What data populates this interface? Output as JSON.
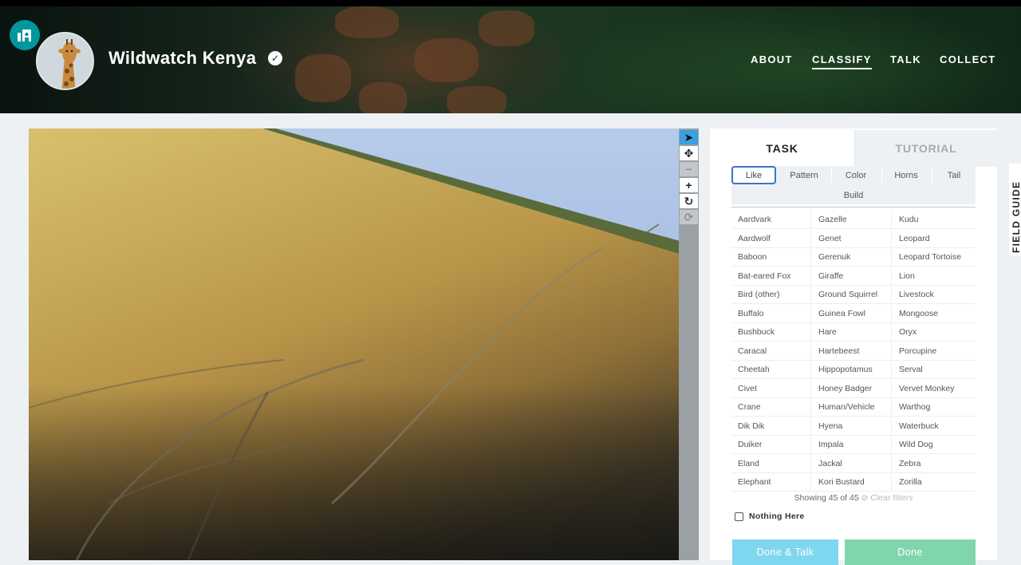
{
  "header": {
    "project_title": "Wildwatch Kenya",
    "verified_icon": "check-circle-icon",
    "nav": [
      "ABOUT",
      "CLASSIFY",
      "TALK",
      "COLLECT"
    ],
    "active_nav": "CLASSIFY"
  },
  "toolbar": {
    "tools": [
      "pointer-icon",
      "move-icon",
      "zoom-out-icon",
      "zoom-in-icon",
      "rotate-icon",
      "reset-icon"
    ]
  },
  "panel": {
    "tabs": {
      "task": "TASK",
      "tutorial": "TUTORIAL"
    },
    "filters": [
      "Like",
      "Pattern",
      "Color",
      "Horns",
      "Tail",
      "Build"
    ],
    "active_filter": "Like",
    "species": [
      [
        "Aardvark",
        "Gazelle",
        "Kudu"
      ],
      [
        "Aardwolf",
        "Genet",
        "Leopard"
      ],
      [
        "Baboon",
        "Gerenuk",
        "Leopard Tortoise"
      ],
      [
        "Bat-eared Fox",
        "Giraffe",
        "Lion"
      ],
      [
        "Bird (other)",
        "Ground Squirrel",
        "Livestock"
      ],
      [
        "Buffalo",
        "Guinea Fowl",
        "Mongoose"
      ],
      [
        "Bushbuck",
        "Hare",
        "Oryx"
      ],
      [
        "Caracal",
        "Hartebeest",
        "Porcupine"
      ],
      [
        "Cheetah",
        "Hippopotamus",
        "Serval"
      ],
      [
        "Civet",
        "Honey Badger",
        "Vervet Monkey"
      ],
      [
        "Crane",
        "Human/Vehicle",
        "Warthog"
      ],
      [
        "Dik Dik",
        "Hyena",
        "Waterbuck"
      ],
      [
        "Duiker",
        "Impala",
        "Wild Dog"
      ],
      [
        "Eland",
        "Jackal",
        "Zebra"
      ],
      [
        "Elephant",
        "Kori Bustard",
        "Zorilla"
      ]
    ],
    "showing": "Showing 45 of 45",
    "clear_filters": "Clear filters",
    "nothing_here": "Nothing Here",
    "done_talk": "Done & Talk",
    "done": "Done"
  },
  "field_guide": "FIELD GUIDE"
}
